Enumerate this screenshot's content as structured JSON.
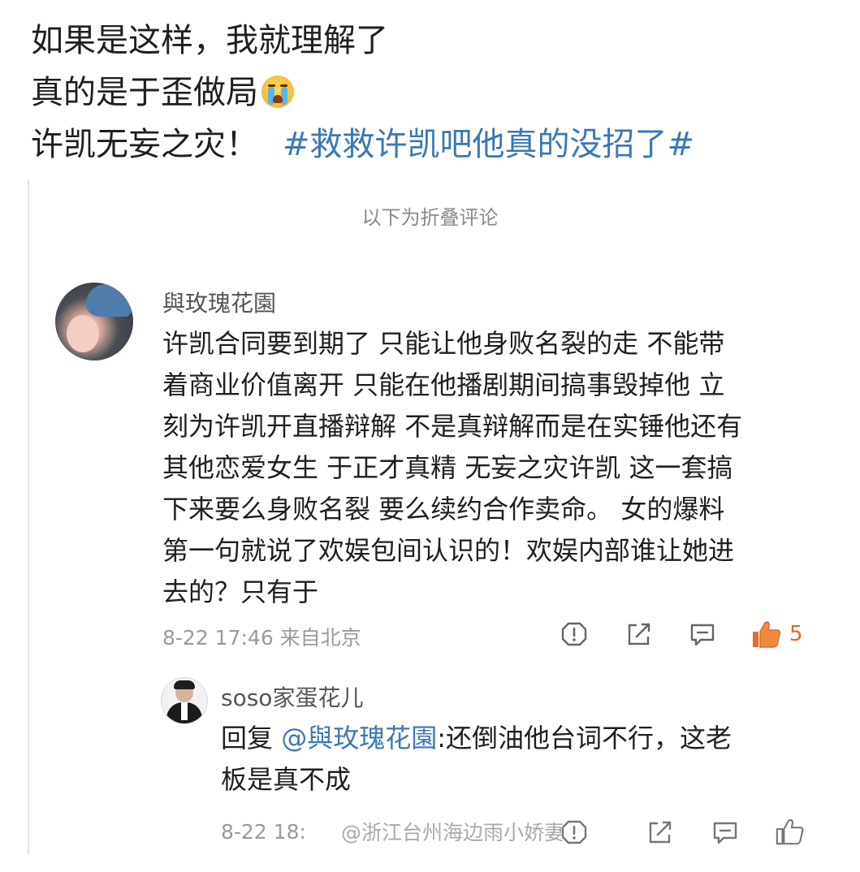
{
  "post": {
    "line1": "如果是这样，我就理解了",
    "line2": "真的是于歪做局",
    "line3_text": "许凯无妄之灾！",
    "hashtag": "#救救许凯吧他真的没招了#"
  },
  "folded_label": "以下为折叠评论",
  "comment": {
    "username": "與玫瑰花園",
    "lines": [
      "许凯合同要到期了 只能让他身败名裂的走 不能带",
      "着商业价值离开 只能在他播剧期间搞事毁掉他 立",
      "刻为许凯开直播辩解 不是真辩解而是在实锤他还有",
      "其他恋爱女生 于正才真精 无妄之灾许凯 这一套搞",
      "下来要么身败名裂 要么续约合作卖命。 女的爆料",
      "第一句就说了欢娱包间认识的！欢娱内部谁让她进",
      "去的？只有于"
    ],
    "meta": "8-22 17:46 来自北京",
    "like_count": "5",
    "icons": [
      "alert-icon",
      "share-icon",
      "comment-icon",
      "like-icon"
    ],
    "like_color": "#e06a2b"
  },
  "reply": {
    "username": "soso家蛋花儿",
    "prefix": "回复 ",
    "mention": "@與玫瑰花園",
    "line1_rest": ":还倒油他台词不行，这老",
    "line2": "板是真不成",
    "meta": "8-22 18:",
    "watermark": "@浙江台州海边雨小娇妻"
  },
  "colors": {
    "link": "#3a78b8",
    "meta": "#9a9a9a",
    "text": "#1f1f1f"
  }
}
